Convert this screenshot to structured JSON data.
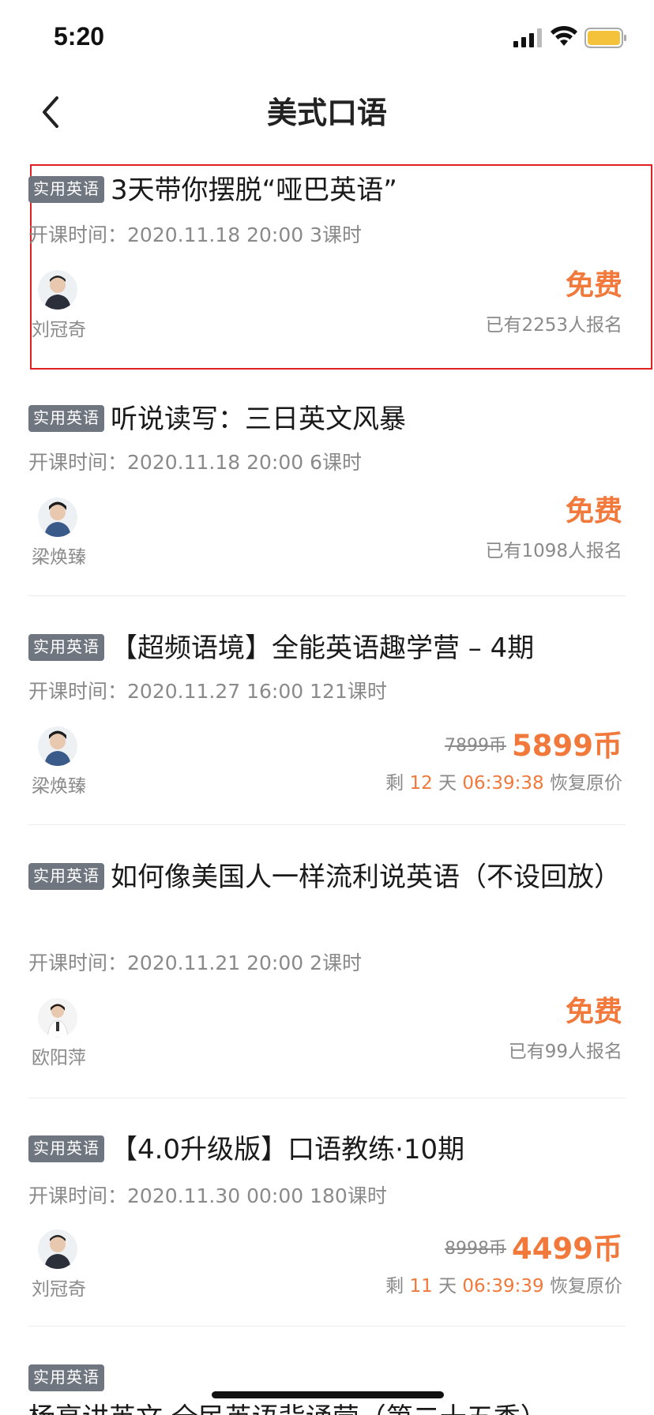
{
  "status_bar": {
    "time": "5:20",
    "icons": [
      "signal-icon",
      "wifi-icon",
      "battery-icon"
    ],
    "battery_color": "#f5c33b"
  },
  "nav": {
    "title": "美式口语",
    "back_icon": "chevron-left-icon"
  },
  "colors": {
    "accent": "#f0793b",
    "tag_bg": "#6f7680",
    "highlight_border": "#e02020"
  },
  "courses": [
    {
      "tag": "实用英语",
      "title": "3天带你摆脱“哑巴英语”",
      "start_label": "开课时间：",
      "start_time": "2020.11.18 20:00",
      "lessons": "3课时",
      "teacher": "刘冠奇",
      "price": "免费",
      "enrolled": "已有2253人报名"
    },
    {
      "tag": "实用英语",
      "title": "听说读写：三日英文风暴",
      "start_label": "开课时间：",
      "start_time": "2020.11.18 20:00",
      "lessons": "6课时",
      "teacher": "梁焕臻",
      "price": "免费",
      "enrolled": "已有1098人报名"
    },
    {
      "tag": "实用英语",
      "title": "【超频语境】全能英语趣学营 – 4期",
      "start_label": "开课时间：",
      "start_time": "2020.11.27 16:00",
      "lessons": "121课时",
      "teacher": "梁焕臻",
      "original_price": "7899币",
      "price": "5899币",
      "countdown_prefix": "剩",
      "countdown_days": "12",
      "countdown_day_unit": "天",
      "countdown_time": "06:39:38",
      "countdown_suffix": "恢复原价"
    },
    {
      "tag": "实用英语",
      "title": "如何像美国人一样流利说英语（不设回放）",
      "start_label": "开课时间：",
      "start_time": "2020.11.21 20:00",
      "lessons": "2课时",
      "teacher": "欧阳萍",
      "price": "免费",
      "enrolled": "已有99人报名"
    },
    {
      "tag": "实用英语",
      "title": "【4.0升级版】口语教练·10期",
      "start_label": "开课时间：",
      "start_time": "2020.11.30 00:00",
      "lessons": "180课时",
      "teacher": "刘冠奇",
      "original_price": "8998币",
      "price": "4499币",
      "countdown_prefix": "剩",
      "countdown_days": "11",
      "countdown_day_unit": "天",
      "countdown_time": "06:39:39",
      "countdown_suffix": "恢复原价"
    },
    {
      "tag": "实用英语",
      "title": "杨亮讲英文·全民英语背诵营（第二十五季）"
    }
  ]
}
